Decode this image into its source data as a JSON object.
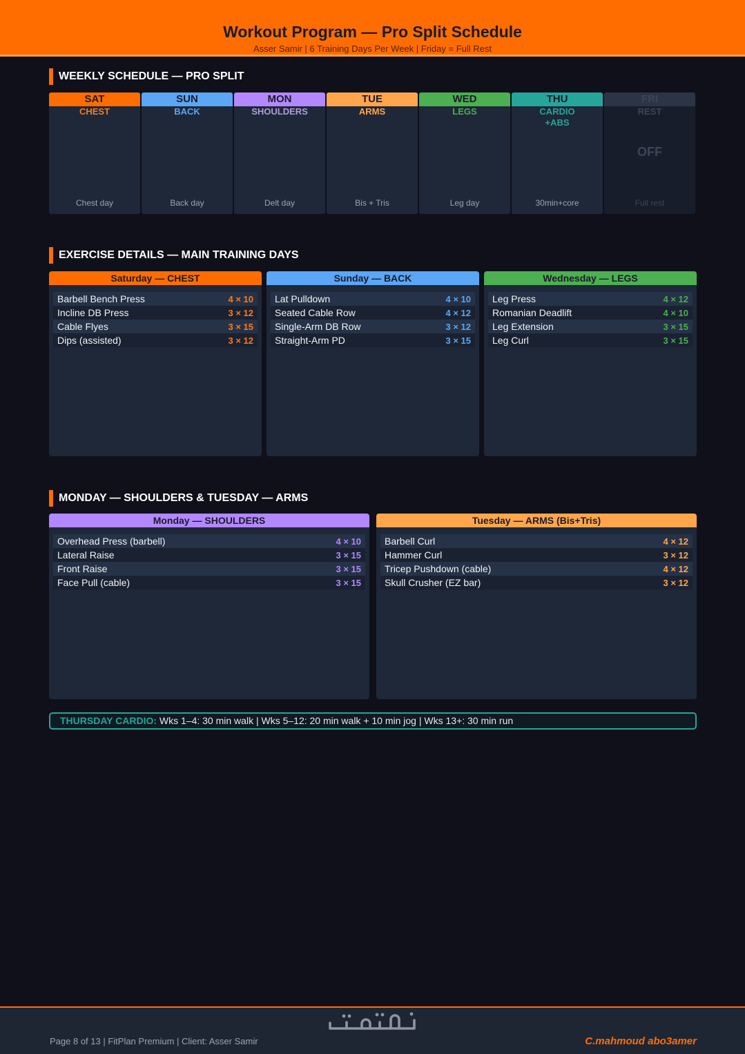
{
  "header": {
    "title": "Workout Program — Pro Split Schedule",
    "subtitle": "Asser Samir  |  6 Training Days Per Week  |  Friday = Full Rest"
  },
  "sections": {
    "weekly": "WEEKLY SCHEDULE — PRO SPLIT",
    "details": "EXERCISE DETAILS — MAIN TRAINING DAYS",
    "mon_tue": "MONDAY — SHOULDERS  &  TUESDAY — ARMS"
  },
  "colors": {
    "orange": "#ff6d00",
    "blue": "#5ba6f5",
    "purple": "#b388ff",
    "peach": "#ffa64d",
    "green": "#4caf50",
    "teal": "#26a69a",
    "rest": "#2b3547"
  },
  "week": [
    {
      "day": "SAT",
      "focus": "CHEST",
      "note": "Chest day",
      "color": "#ff6d00",
      "text_color": "#ff7a1a"
    },
    {
      "day": "SUN",
      "focus": "BACK",
      "note": "Back day",
      "color": "#5ba6f5",
      "text_color": "#5ba6f5"
    },
    {
      "day": "MON",
      "focus": "SHOULDERS",
      "note": "Delt day",
      "color": "#b388ff",
      "text_color": "#b39ddb"
    },
    {
      "day": "TUE",
      "focus": "ARMS",
      "note": "Bis + Tris",
      "color": "#ffa64d",
      "text_color": "#ffa64d"
    },
    {
      "day": "WED",
      "focus": "LEGS",
      "note": "Leg day",
      "color": "#4caf50",
      "text_color": "#4caf50"
    },
    {
      "day": "THU",
      "focus": "CARDIO\n+ABS",
      "note": "30min+core",
      "color": "#26a69a",
      "text_color": "#26a69a"
    },
    {
      "day": "FRI",
      "focus": "REST",
      "note": "Full rest",
      "off": "OFF",
      "color": "#2b3547",
      "text_color": "#3c4656"
    }
  ],
  "cards": {
    "saturday": {
      "title": "Saturday — CHEST",
      "color": "#ff6d00",
      "accent": "#ff7a1a",
      "exercises": [
        {
          "name": "Barbell Bench Press",
          "sets": "4 × 10"
        },
        {
          "name": "Incline DB Press",
          "sets": "3 × 12"
        },
        {
          "name": "Cable Flyes",
          "sets": "3 × 15"
        },
        {
          "name": "Dips (assisted)",
          "sets": "3 × 12"
        }
      ]
    },
    "sunday": {
      "title": "Sunday — BACK",
      "color": "#5ba6f5",
      "accent": "#5ba6f5",
      "exercises": [
        {
          "name": "Lat Pulldown",
          "sets": "4 × 10"
        },
        {
          "name": "Seated Cable Row",
          "sets": "4 × 12"
        },
        {
          "name": "Single-Arm DB Row",
          "sets": "3 × 12"
        },
        {
          "name": "Straight-Arm PD",
          "sets": "3 × 15"
        }
      ]
    },
    "wednesday": {
      "title": "Wednesday — LEGS",
      "color": "#4caf50",
      "accent": "#4caf50",
      "exercises": [
        {
          "name": "Leg Press",
          "sets": "4 × 12"
        },
        {
          "name": "Romanian Deadlift",
          "sets": "4 × 10"
        },
        {
          "name": "Leg Extension",
          "sets": "3 × 15"
        },
        {
          "name": "Leg Curl",
          "sets": "3 × 15"
        }
      ]
    },
    "monday": {
      "title": "Monday — SHOULDERS",
      "color": "#b388ff",
      "accent": "#b388ff",
      "exercises": [
        {
          "name": "Overhead Press (barbell)",
          "sets": "4 × 10"
        },
        {
          "name": "Lateral Raise",
          "sets": "3 × 15"
        },
        {
          "name": "Front Raise",
          "sets": "3 × 15"
        },
        {
          "name": "Face Pull (cable)",
          "sets": "3 × 15"
        }
      ]
    },
    "tuesday": {
      "title": "Tuesday — ARMS (Bis+Tris)",
      "color": "#ffa64d",
      "accent": "#ffa64d",
      "exercises": [
        {
          "name": "Barbell Curl",
          "sets": "4 × 12"
        },
        {
          "name": "Hammer Curl",
          "sets": "3 × 12"
        },
        {
          "name": "Tricep Pushdown (cable)",
          "sets": "4 × 12"
        },
        {
          "name": "Skull Crusher (EZ bar)",
          "sets": "3 × 12"
        }
      ]
    }
  },
  "cardio": {
    "label": "THURSDAY CARDIO:",
    "text": " Wks 1–4: 30 min walk  |  Wks 5–12: 20 min walk + 10 min jog  |  Wks 13+: 30 min run"
  },
  "footer": {
    "left": "Page 8 of 13  |  FitPlan Premium  |  Client: Asser Samir",
    "right": "C.mahmoud abo3amer",
    "logo_text": "خمسات"
  }
}
